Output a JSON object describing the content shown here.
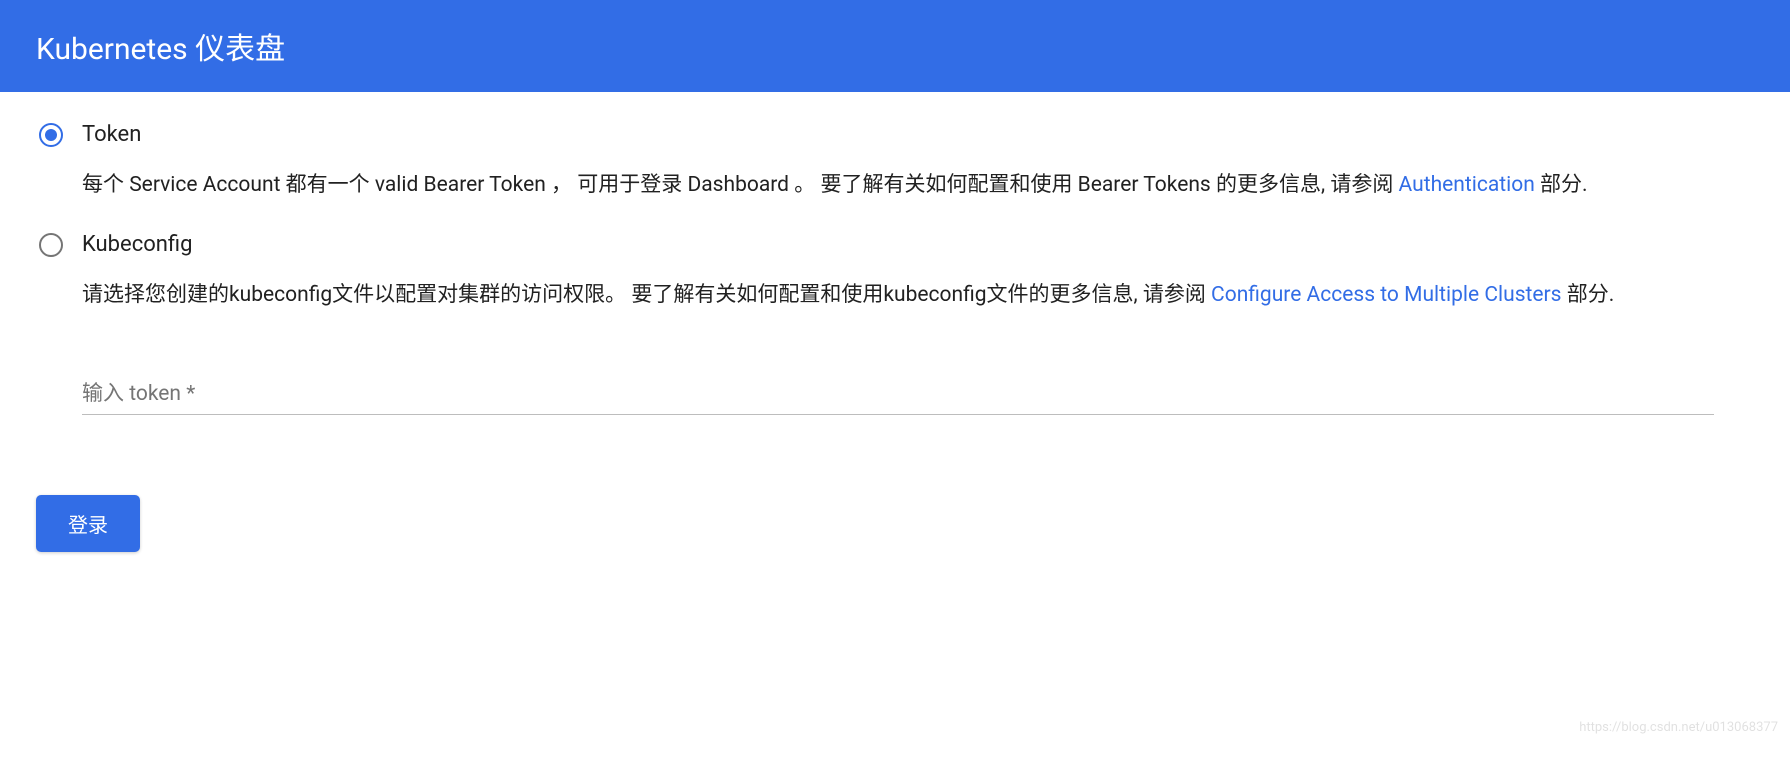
{
  "header": {
    "title": "Kubernetes 仪表盘"
  },
  "options": {
    "token": {
      "label": "Token",
      "desc_pre": "每个 Service Account 都有一个 valid Bearer Token ， 可用于登录 Dashboard 。 要了解有关如何配置和使用 Bearer Tokens 的更多信息,  请参阅 ",
      "link_text": "Authentication",
      "desc_post": " 部分."
    },
    "kubeconfig": {
      "label": "Kubeconfig",
      "desc_pre": "请选择您创建的kubeconfig文件以配置对集群的访问权限。 要了解有关如何配置和使用kubeconfig文件的更多信息,  请参阅 ",
      "link_text": "Configure Access to Multiple Clusters",
      "desc_post": " 部分."
    }
  },
  "input": {
    "placeholder": "输入 token *",
    "value": ""
  },
  "actions": {
    "login": "登录"
  },
  "watermark": "https://blog.csdn.net/u013068377"
}
